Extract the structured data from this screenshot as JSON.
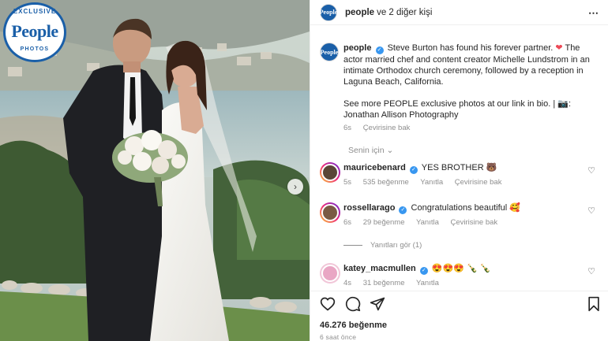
{
  "badge": {
    "top": "EXCLUSIVE",
    "logo": "People",
    "bottom": "PHOTOS"
  },
  "header": {
    "account": "people",
    "rest": "ve 2 diğer kişi",
    "avatar_text": "People"
  },
  "caption": {
    "account": "people",
    "text1": "Steve Burton has found his forever partner.",
    "text2": "The actor married chef and content creator Michelle Lundstrom in an intimate Orthodox church ceremony, followed by a reception in Laguna Beach, California.",
    "text3": "See more PEOPLE exclusive photos at our link in bio. | 📷: Jonathan Allison Photography",
    "age": "6s",
    "translate": "Çevirisine bak"
  },
  "filter": "Senin için",
  "comments": [
    {
      "user": "mauricebenard",
      "verified": true,
      "text": "YES BROTHER 🐻",
      "age": "5s",
      "likes": "535 beğenme",
      "reply": "Yanıtla",
      "translate": "Çevirisine bak"
    },
    {
      "user": "rossellarago",
      "verified": true,
      "text": "Congratulations beautiful 🥰",
      "age": "6s",
      "likes": "29 beğenme",
      "reply": "Yanıtla",
      "translate": "Çevirisine bak"
    },
    {
      "user": "katey_macmullen",
      "verified": true,
      "text": "😍😍😍 🍾 🍾",
      "age": "4s",
      "likes": "31 beğenme",
      "reply": "Yanıtla"
    }
  ],
  "replies": "Yanıtları gör (1)",
  "likes": "46.276 beğenme",
  "time": "6 saat önce",
  "colors": {
    "brand": "#1a5fa8",
    "verified": "#3897f0",
    "heart": "#ed4956",
    "muted": "#8e8e8e"
  }
}
